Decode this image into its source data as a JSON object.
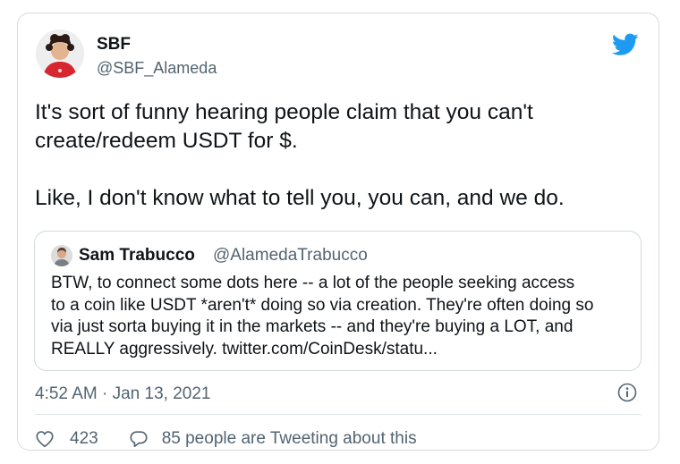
{
  "tweet": {
    "display_name": "SBF",
    "handle": "@SBF_Alameda",
    "text_lines": [
      "It's sort of funny hearing people claim that you can't",
      "create/redeem USDT for $.",
      "",
      "Like, I don't know what to tell you, you can, and we do."
    ],
    "timestamp": "4:52 AM · Jan 13, 2021",
    "like_count": "423",
    "tweeting_about": "85 people are Tweeting about this"
  },
  "quoted_tweet": {
    "display_name": "Sam Trabucco",
    "handle": "@AlamedaTrabucco",
    "text_lines": [
      "BTW, to connect some dots here -- a lot of the people seeking access",
      "to a coin like USDT *aren't* doing so via creation. They're often doing so",
      "via just sorta buying it in the markets -- and they're buying a LOT, and",
      "REALLY aggressively. twitter.com/CoinDesk/statu..."
    ]
  },
  "icons": {
    "brand": "twitter-bird-icon",
    "info": "info-icon",
    "like": "heart-icon",
    "reply": "speech-bubble-icon"
  },
  "colors": {
    "brand_blue": "#1d9bf0",
    "text_primary": "#0f1419",
    "text_secondary": "#536471",
    "border": "#cfd9de"
  }
}
